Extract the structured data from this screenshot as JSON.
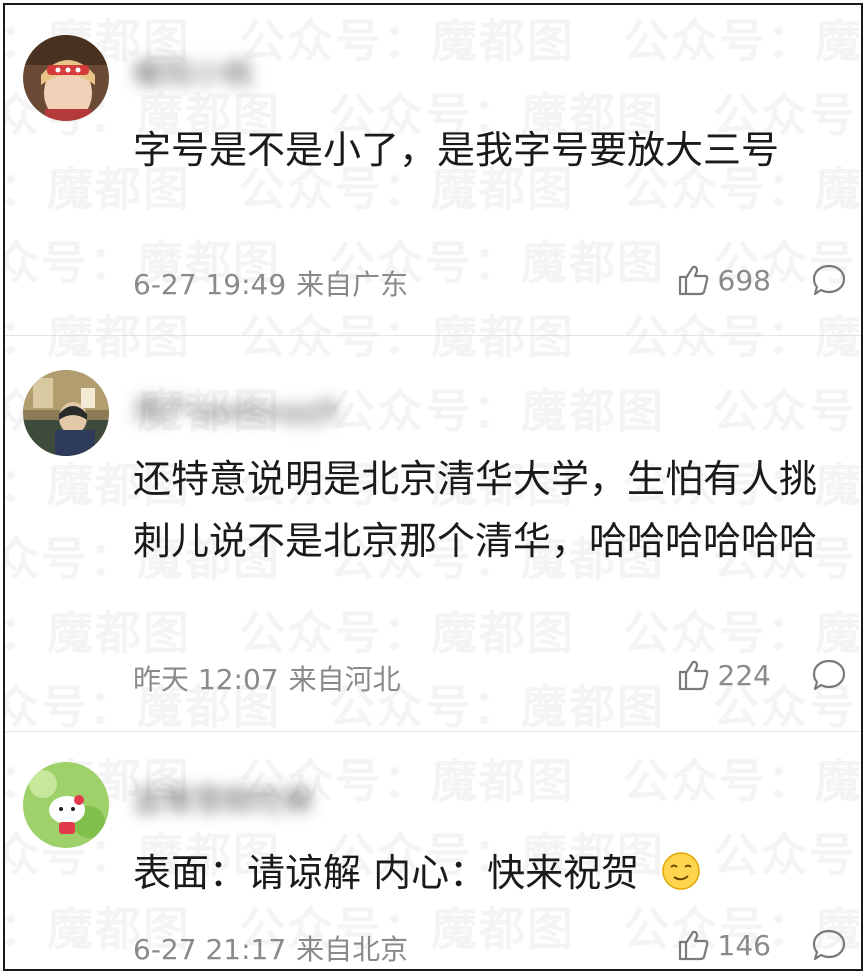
{
  "watermark": {
    "text": "公众号：魔都图"
  },
  "comments": [
    {
      "username": "暖阳小桃",
      "text": "字号是不是小了，是我字号要放大三号",
      "time": "6-27 19:49",
      "location": "来自广东",
      "likes": "698"
    },
    {
      "username": "用户seebsqq9",
      "text": "还特意说明是北京清华大学，生怕有人挑刺儿说不是北京那个清华，哈哈哈哈哈哈",
      "time": "昨天 12:07",
      "location": "来自河北",
      "likes": "224"
    },
    {
      "username": "蓝莓雪糕吃嘛",
      "text": "表面：请谅解 内心：快来祝贺",
      "time": "6-27 21:17",
      "location": "来自北京",
      "likes": "146"
    }
  ],
  "colors": {
    "text": "#1a1a1a",
    "meta": "#8a8a8a",
    "divider": "#e3e3e3"
  }
}
